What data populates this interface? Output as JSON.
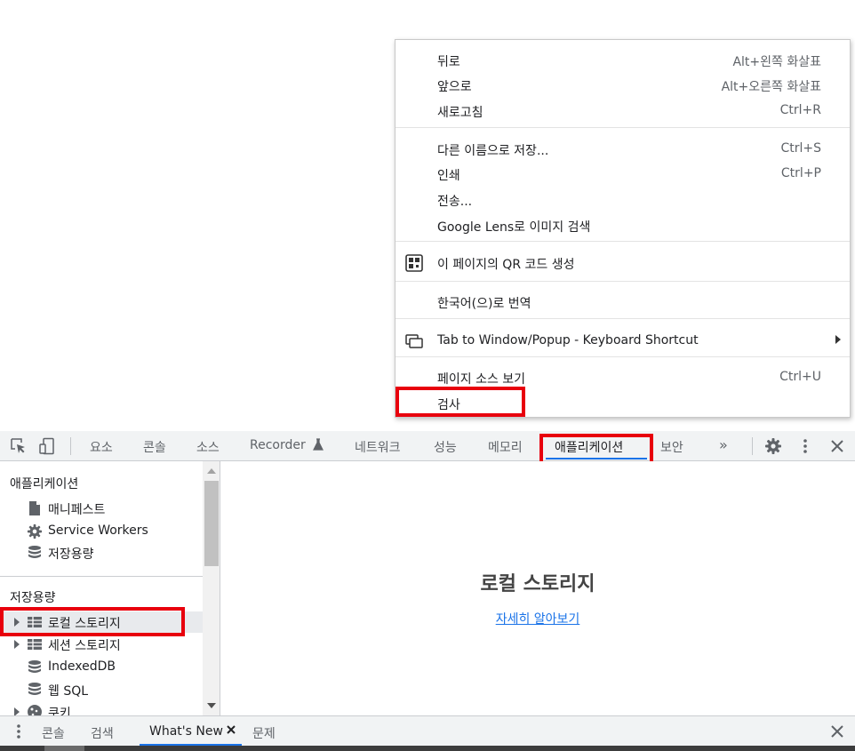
{
  "context_menu": {
    "items": [
      {
        "label": "뒤로",
        "shortcut": "Alt+왼쪽 화살표"
      },
      {
        "label": "앞으로",
        "shortcut": "Alt+오른쪽 화살표"
      },
      {
        "label": "새로고침",
        "shortcut": "Ctrl+R"
      },
      {
        "label": "다른 이름으로 저장...",
        "shortcut": "Ctrl+S"
      },
      {
        "label": "인쇄",
        "shortcut": "Ctrl+P"
      },
      {
        "label": "전송..."
      },
      {
        "label": "Google Lens로 이미지 검색"
      },
      {
        "label": "이 페이지의 QR 코드 생성",
        "icon": "qr-code-icon"
      },
      {
        "label": "한국어(으)로 번역"
      },
      {
        "label": "Tab to Window/Popup - Keyboard Shortcut",
        "icon": "tab-window-icon",
        "submenu": true
      },
      {
        "label": "페이지 소스 보기",
        "shortcut": "Ctrl+U"
      },
      {
        "label": "검사"
      }
    ]
  },
  "devtools": {
    "toolbar": {
      "tabs": [
        {
          "label": "요소"
        },
        {
          "label": "콘솔"
        },
        {
          "label": "소스"
        },
        {
          "label": "Recorder",
          "icon": "flask-icon"
        },
        {
          "label": "네트워크"
        },
        {
          "label": "성능"
        },
        {
          "label": "메모리"
        },
        {
          "label": "애플리케이션",
          "active": true
        },
        {
          "label": "보안"
        }
      ],
      "more": "»"
    },
    "sidebar": {
      "section_app": "애플리케이션",
      "app_items": [
        {
          "label": "매니페스트",
          "icon": "document-icon"
        },
        {
          "label": "Service Workers",
          "icon": "gear-icon"
        },
        {
          "label": "저장용량",
          "icon": "database-icon"
        }
      ],
      "section_storage": "저장용량",
      "storage_items": [
        {
          "label": "로컬 스토리지",
          "icon": "table-icon",
          "expandable": true,
          "selected": true
        },
        {
          "label": "세션 스토리지",
          "icon": "table-icon",
          "expandable": true
        },
        {
          "label": "IndexedDB",
          "icon": "database-icon"
        },
        {
          "label": "웹 SQL",
          "icon": "database-icon"
        },
        {
          "label": "쿠키",
          "icon": "cookie-icon",
          "expandable": true
        }
      ]
    },
    "main": {
      "title": "로컬 스토리지",
      "link": "자세히 알아보기"
    },
    "drawer": {
      "tabs": [
        {
          "label": "콘솔"
        },
        {
          "label": "검색"
        },
        {
          "label": "What's New",
          "active": true,
          "closable": true
        },
        {
          "label": "문제"
        }
      ]
    }
  },
  "colors": {
    "highlight_box": "#e8000d",
    "accent": "#1a73e8",
    "toolbar_bg": "#f1f3f4"
  }
}
